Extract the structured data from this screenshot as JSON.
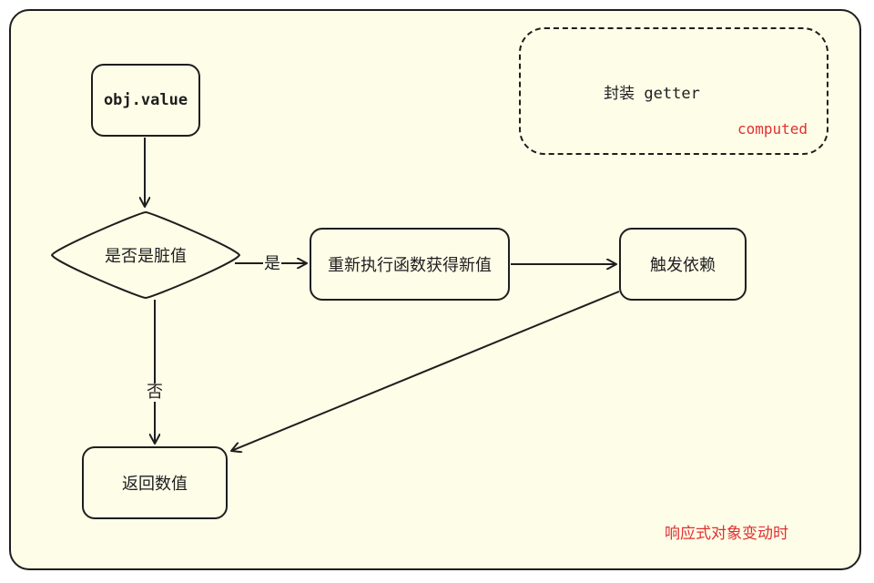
{
  "colors": {
    "background": "#fefde8",
    "stroke": "#1e1e1e",
    "accent_red": "#e03131"
  },
  "nodes": {
    "start": "obj.value",
    "decision": "是否是脏值",
    "recompute": "重新执行函数获得新值",
    "trigger": "触发依赖",
    "return": "返回数值"
  },
  "edges": {
    "yes_label": "是",
    "no_label": "否"
  },
  "getter_box": {
    "title": "封装 getter",
    "tag": "computed"
  },
  "note": "响应式对象变动时"
}
